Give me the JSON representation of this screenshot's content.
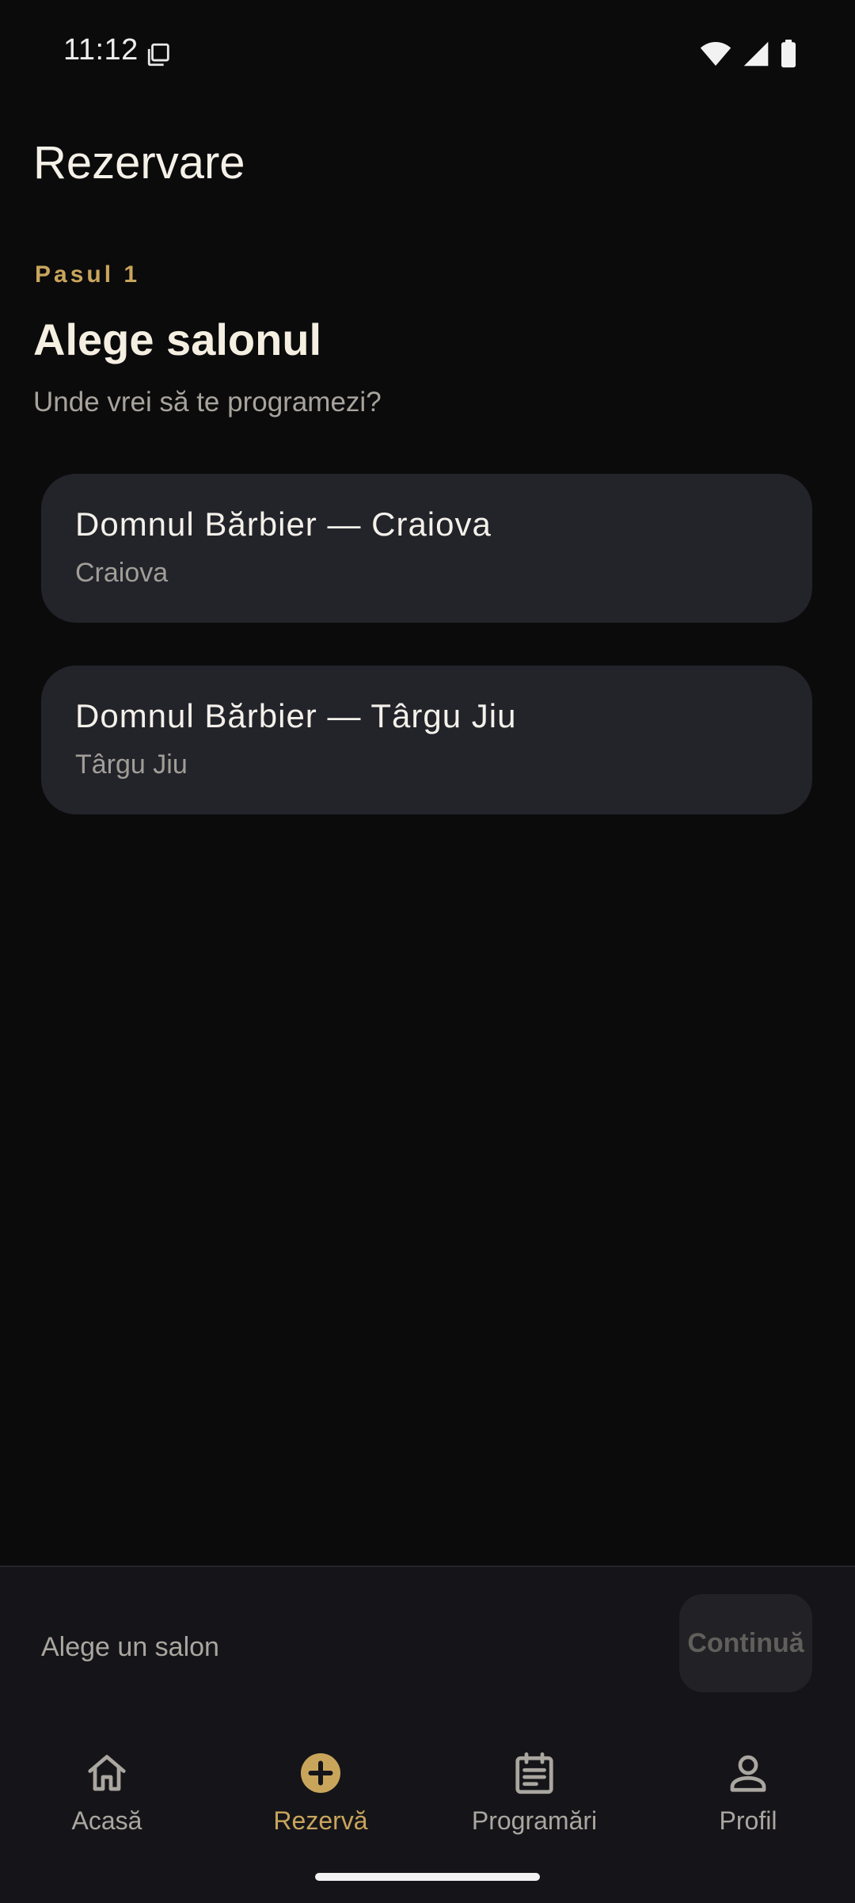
{
  "status_bar": {
    "time": "11:12"
  },
  "header": {
    "title": "Rezervare"
  },
  "step": {
    "label": "Pasul 1",
    "title": "Alege salonul",
    "subtitle": "Unde vrei să te programezi?"
  },
  "salons": [
    {
      "name": "Domnul Bărbier — Craiova",
      "city": "Craiova"
    },
    {
      "name": "Domnul Bărbier — Târgu Jiu",
      "city": "Târgu Jiu"
    }
  ],
  "footer": {
    "hint": "Alege un salon",
    "continue_label": "Continuă"
  },
  "nav": {
    "items": [
      {
        "label": "Acasă",
        "icon": "home-icon",
        "active": false
      },
      {
        "label": "Rezervă",
        "icon": "add-circle-icon",
        "active": true
      },
      {
        "label": "Programări",
        "icon": "calendar-list-icon",
        "active": false
      },
      {
        "label": "Profil",
        "icon": "person-icon",
        "active": false
      }
    ]
  },
  "colors": {
    "background": "#0b0b0c",
    "card": "#23232a",
    "accent": "#c9a55c",
    "text_primary": "#f5f1e8",
    "text_secondary": "#a8a49d"
  }
}
